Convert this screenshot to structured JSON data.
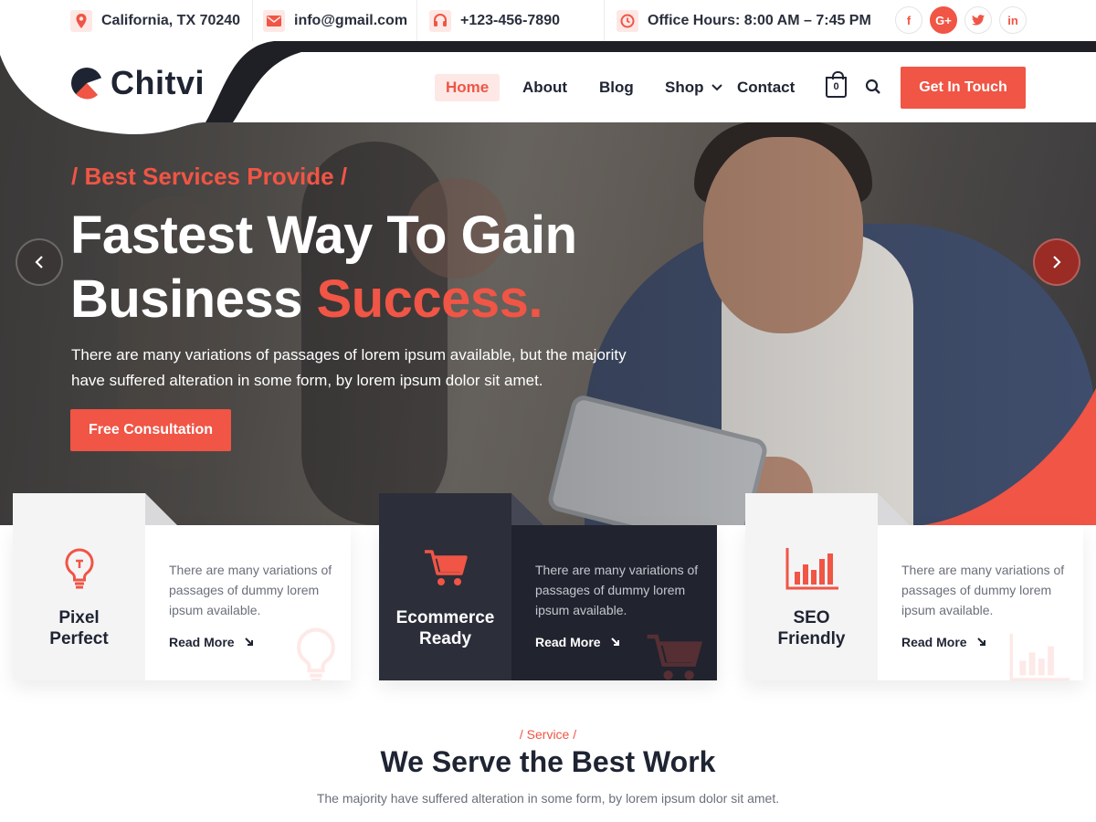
{
  "topbar": {
    "address": "California, TX 70240",
    "email": "info@gmail.com",
    "phone": "+123-456-7890",
    "hours": "Office Hours: 8:00 AM – 7:45 PM",
    "social": [
      {
        "icon": "facebook-icon",
        "label": "f"
      },
      {
        "icon": "google-plus-icon",
        "label": "G+"
      },
      {
        "icon": "twitter-icon",
        "label": "t"
      },
      {
        "icon": "linkedin-icon",
        "label": "in"
      }
    ]
  },
  "brand": {
    "name": "Chitvi"
  },
  "nav": {
    "items": [
      "Home",
      "About",
      "Blog",
      "Shop",
      "Contact"
    ],
    "active": "Home",
    "cart_count": "0",
    "cta": "Get In Touch"
  },
  "hero": {
    "eyebrow": "/ Best Services Provide /",
    "headline_line1": "Fastest Way To Gain",
    "headline_line2": "Business",
    "headline_accent": "Success.",
    "lead": "There are many variations of passages of lorem ipsum available, but the majority have suffered alteration in some form, by lorem ipsum dolor sit amet.",
    "button": "Free Consultation"
  },
  "features": [
    {
      "icon": "lightbulb-icon",
      "title_1": "Pixel",
      "title_2": "Perfect",
      "text": "There are many variations of passages of dummy lorem ipsum available.",
      "link": "Read More"
    },
    {
      "icon": "cart-icon",
      "title_1": "Ecommerce",
      "title_2": "Ready",
      "text": "There are many variations of passages of dummy lorem ipsum available.",
      "link": "Read More"
    },
    {
      "icon": "bar-chart-icon",
      "title_1": "SEO",
      "title_2": "Friendly",
      "text": "There are many variations of passages of dummy lorem ipsum available.",
      "link": "Read More"
    }
  ],
  "service": {
    "eyebrow": "/ Service /",
    "title": "We Serve the Best Work",
    "subtitle": "The majority have suffered alteration in some form, by lorem ipsum dolor sit amet."
  },
  "colors": {
    "accent": "#f05545",
    "dark": "#21232e",
    "text": "#1f2433"
  }
}
